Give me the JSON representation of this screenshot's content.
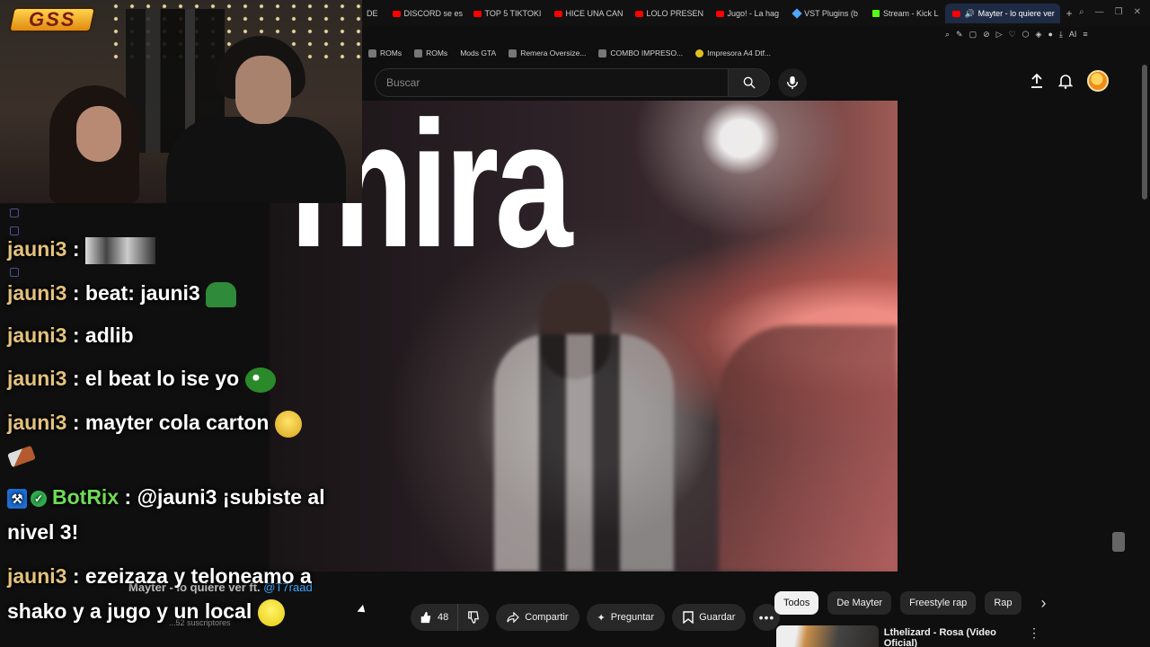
{
  "browser": {
    "tabs": [
      {
        "label": "DE",
        "icon": "none"
      },
      {
        "label": "DISCORD se es",
        "icon": "youtube"
      },
      {
        "label": "TOP 5 TIKTOKI",
        "icon": "youtube"
      },
      {
        "label": "HICE UNA CAN",
        "icon": "youtube"
      },
      {
        "label": "LOLO PRESEN",
        "icon": "youtube"
      },
      {
        "label": "Jugo! - La hag",
        "icon": "youtube"
      },
      {
        "label": "VST Plugins (b",
        "icon": "vst"
      },
      {
        "label": "Stream - Kick L",
        "icon": "kick"
      },
      {
        "label": "Mayter - lo quiere ver",
        "icon": "youtube",
        "active": true
      }
    ],
    "new_tab": "+",
    "bookmarks": [
      "ROMs",
      "ROMs",
      "Mods GTA",
      "Remera Oversize...",
      "COMBO IMPRESO...",
      "Impresora A4 Dtf..."
    ],
    "ai_label": "AI"
  },
  "youtube": {
    "search_placeholder": "Buscar",
    "video_overlay_text": "mira",
    "title_text": "Mayter - lo quiere ver ft.",
    "title_mention": "@T7raad",
    "subscribers": "...52 suscriptores",
    "likes": "48",
    "share_label": "Compartir",
    "ask_label": "Preguntar",
    "save_label": "Guardar",
    "chips": [
      "Todos",
      "De Mayter",
      "Freestyle rap",
      "Rap"
    ],
    "recommended_title": "Lthelizard - Rosa (Video Oficial)"
  },
  "stream": {
    "logo": "GSS"
  },
  "chat": [
    {
      "user": "jauni3",
      "text": "",
      "emote": "img"
    },
    {
      "user": "jauni3",
      "text": "beat: jauni3",
      "emote": "frog"
    },
    {
      "user": "jauni3",
      "text": "adlib",
      "emote": ""
    },
    {
      "user": "jauni3",
      "text": "el beat lo ise yo",
      "emote": "pepe"
    },
    {
      "user": "jauni3",
      "text": "mayter cola carton",
      "emote": "smile"
    },
    {
      "user": "BotRix",
      "text": "@jauni3 ¡subiste al nivel 3!",
      "emote": ""
    },
    {
      "user": "jauni3",
      "text": "ezeizaza y teloneamo a shako y a jugo y un local",
      "emote": "smile2"
    }
  ],
  "colors": {
    "username": "#e3c27c",
    "bot": "#6fdc57",
    "youtube_red": "#ff0000",
    "kick_green": "#53fc18",
    "background": "#0f0f0f"
  }
}
